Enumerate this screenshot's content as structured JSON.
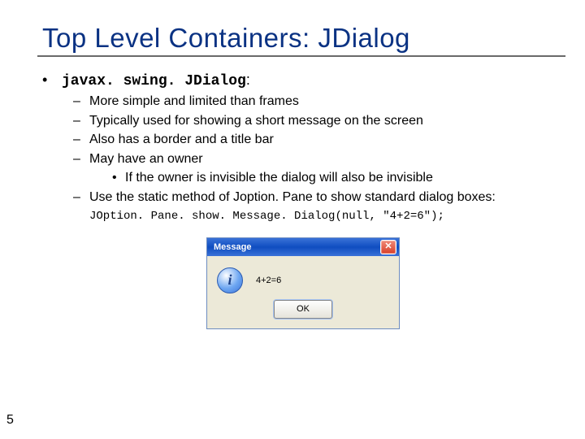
{
  "title": "Top Level Containers: JDialog",
  "heading_code": "javax. swing. JDialog",
  "heading_suffix": ":",
  "bullets": {
    "b1": "More simple and limited than frames",
    "b2": "Typically used for showing a short message on the screen",
    "b3": "Also has a border and a title bar",
    "b4": "May have an owner",
    "b4a": "If the owner is invisible the dialog will also be invisible",
    "b5": "Use the static method of Joption. Pane to show standard dialog boxes:"
  },
  "code_line": "JOption. Pane. show. Message. Dialog(null, \"4+2=6\");",
  "dialog": {
    "title": "Message",
    "message": "4+2=6",
    "ok": "OK",
    "close_glyph": "✕",
    "info_glyph": "i"
  },
  "page_number": "5"
}
